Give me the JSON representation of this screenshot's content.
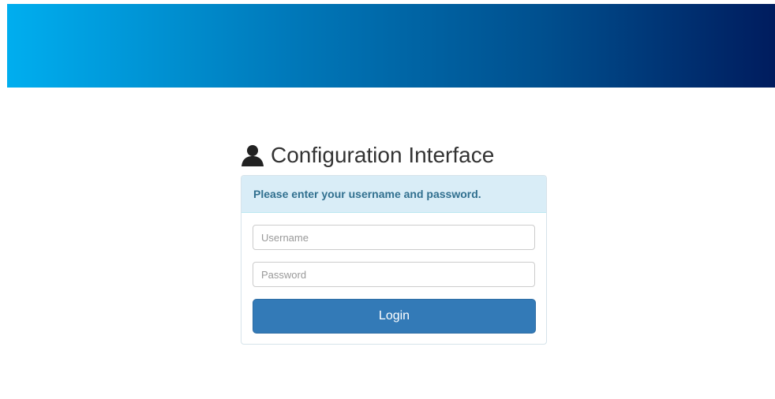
{
  "header": {
    "banner_colors": [
      "#00aeef",
      "#0077b8",
      "#004f8e",
      "#001c5e"
    ]
  },
  "login": {
    "title": "Configuration Interface",
    "title_icon": "user-icon",
    "prompt": "Please enter your username and password.",
    "username": {
      "placeholder": "Username",
      "value": ""
    },
    "password": {
      "placeholder": "Password",
      "value": ""
    },
    "submit_label": "Login"
  },
  "colors": {
    "heading_bg": "#d9edf7",
    "heading_text": "#31708f",
    "button_bg": "#337ab7"
  }
}
